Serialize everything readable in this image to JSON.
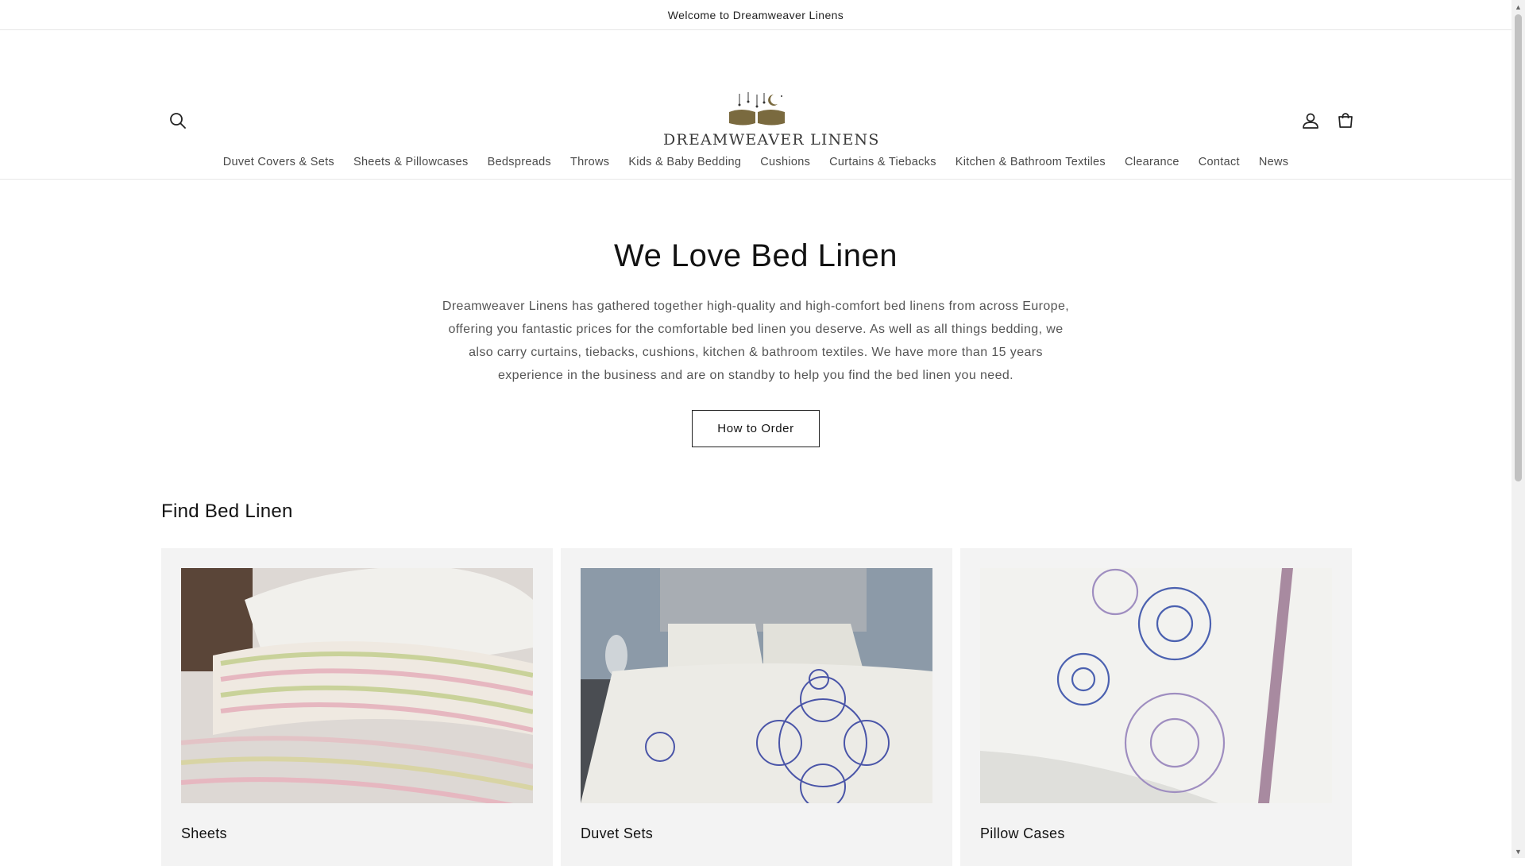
{
  "announcement": {
    "text": "Welcome to Dreamweaver Linens"
  },
  "header": {
    "logo_text": "DREAMWEAVER LINENS",
    "icons": {
      "search": "search-icon",
      "account": "user-icon",
      "cart": "cart-icon"
    }
  },
  "nav": {
    "items": [
      {
        "label": "Duvet Covers & Sets"
      },
      {
        "label": "Sheets & Pillowcases"
      },
      {
        "label": "Bedspreads"
      },
      {
        "label": "Throws"
      },
      {
        "label": "Kids & Baby Bedding"
      },
      {
        "label": "Cushions"
      },
      {
        "label": "Curtains & Tiebacks"
      },
      {
        "label": "Kitchen & Bathroom Textiles"
      },
      {
        "label": "Clearance"
      },
      {
        "label": "Contact"
      },
      {
        "label": "News"
      }
    ]
  },
  "hero": {
    "title": "We Love Bed Linen",
    "text": "Dreamweaver Linens has gathered together high-quality and high-comfort bed linens from across Europe, offering you fantastic prices for the comfortable bed linen you deserve. As well as all things bedding, we also carry curtains, tiebacks, cushions, kitchen & bathroom textiles. We have more than 15 years experience in the business and are on standby to help you find the bed linen you need.",
    "button_label": "How to Order"
  },
  "collections": {
    "title": "Find Bed Linen",
    "items": [
      {
        "label": "Sheets"
      },
      {
        "label": "Duvet Sets"
      },
      {
        "label": "Pillow Cases"
      }
    ]
  },
  "colors": {
    "logo_brown": "#7a6a3f",
    "text": "#121212",
    "card_bg": "#f3f3f3"
  }
}
